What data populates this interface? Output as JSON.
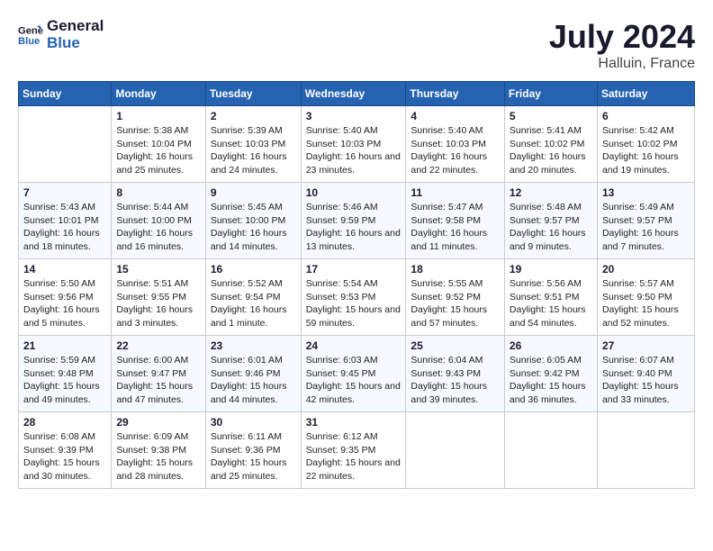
{
  "header": {
    "logo_line1": "General",
    "logo_line2": "Blue",
    "month_year": "July 2024",
    "location": "Halluin, France"
  },
  "weekdays": [
    "Sunday",
    "Monday",
    "Tuesday",
    "Wednesday",
    "Thursday",
    "Friday",
    "Saturday"
  ],
  "weeks": [
    [
      {
        "day": "",
        "sunrise": "",
        "sunset": "",
        "daylight": ""
      },
      {
        "day": "1",
        "sunrise": "Sunrise: 5:38 AM",
        "sunset": "Sunset: 10:04 PM",
        "daylight": "Daylight: 16 hours and 25 minutes."
      },
      {
        "day": "2",
        "sunrise": "Sunrise: 5:39 AM",
        "sunset": "Sunset: 10:03 PM",
        "daylight": "Daylight: 16 hours and 24 minutes."
      },
      {
        "day": "3",
        "sunrise": "Sunrise: 5:40 AM",
        "sunset": "Sunset: 10:03 PM",
        "daylight": "Daylight: 16 hours and 23 minutes."
      },
      {
        "day": "4",
        "sunrise": "Sunrise: 5:40 AM",
        "sunset": "Sunset: 10:03 PM",
        "daylight": "Daylight: 16 hours and 22 minutes."
      },
      {
        "day": "5",
        "sunrise": "Sunrise: 5:41 AM",
        "sunset": "Sunset: 10:02 PM",
        "daylight": "Daylight: 16 hours and 20 minutes."
      },
      {
        "day": "6",
        "sunrise": "Sunrise: 5:42 AM",
        "sunset": "Sunset: 10:02 PM",
        "daylight": "Daylight: 16 hours and 19 minutes."
      }
    ],
    [
      {
        "day": "7",
        "sunrise": "Sunrise: 5:43 AM",
        "sunset": "Sunset: 10:01 PM",
        "daylight": "Daylight: 16 hours and 18 minutes."
      },
      {
        "day": "8",
        "sunrise": "Sunrise: 5:44 AM",
        "sunset": "Sunset: 10:00 PM",
        "daylight": "Daylight: 16 hours and 16 minutes."
      },
      {
        "day": "9",
        "sunrise": "Sunrise: 5:45 AM",
        "sunset": "Sunset: 10:00 PM",
        "daylight": "Daylight: 16 hours and 14 minutes."
      },
      {
        "day": "10",
        "sunrise": "Sunrise: 5:46 AM",
        "sunset": "Sunset: 9:59 PM",
        "daylight": "Daylight: 16 hours and 13 minutes."
      },
      {
        "day": "11",
        "sunrise": "Sunrise: 5:47 AM",
        "sunset": "Sunset: 9:58 PM",
        "daylight": "Daylight: 16 hours and 11 minutes."
      },
      {
        "day": "12",
        "sunrise": "Sunrise: 5:48 AM",
        "sunset": "Sunset: 9:57 PM",
        "daylight": "Daylight: 16 hours and 9 minutes."
      },
      {
        "day": "13",
        "sunrise": "Sunrise: 5:49 AM",
        "sunset": "Sunset: 9:57 PM",
        "daylight": "Daylight: 16 hours and 7 minutes."
      }
    ],
    [
      {
        "day": "14",
        "sunrise": "Sunrise: 5:50 AM",
        "sunset": "Sunset: 9:56 PM",
        "daylight": "Daylight: 16 hours and 5 minutes."
      },
      {
        "day": "15",
        "sunrise": "Sunrise: 5:51 AM",
        "sunset": "Sunset: 9:55 PM",
        "daylight": "Daylight: 16 hours and 3 minutes."
      },
      {
        "day": "16",
        "sunrise": "Sunrise: 5:52 AM",
        "sunset": "Sunset: 9:54 PM",
        "daylight": "Daylight: 16 hours and 1 minute."
      },
      {
        "day": "17",
        "sunrise": "Sunrise: 5:54 AM",
        "sunset": "Sunset: 9:53 PM",
        "daylight": "Daylight: 15 hours and 59 minutes."
      },
      {
        "day": "18",
        "sunrise": "Sunrise: 5:55 AM",
        "sunset": "Sunset: 9:52 PM",
        "daylight": "Daylight: 15 hours and 57 minutes."
      },
      {
        "day": "19",
        "sunrise": "Sunrise: 5:56 AM",
        "sunset": "Sunset: 9:51 PM",
        "daylight": "Daylight: 15 hours and 54 minutes."
      },
      {
        "day": "20",
        "sunrise": "Sunrise: 5:57 AM",
        "sunset": "Sunset: 9:50 PM",
        "daylight": "Daylight: 15 hours and 52 minutes."
      }
    ],
    [
      {
        "day": "21",
        "sunrise": "Sunrise: 5:59 AM",
        "sunset": "Sunset: 9:48 PM",
        "daylight": "Daylight: 15 hours and 49 minutes."
      },
      {
        "day": "22",
        "sunrise": "Sunrise: 6:00 AM",
        "sunset": "Sunset: 9:47 PM",
        "daylight": "Daylight: 15 hours and 47 minutes."
      },
      {
        "day": "23",
        "sunrise": "Sunrise: 6:01 AM",
        "sunset": "Sunset: 9:46 PM",
        "daylight": "Daylight: 15 hours and 44 minutes."
      },
      {
        "day": "24",
        "sunrise": "Sunrise: 6:03 AM",
        "sunset": "Sunset: 9:45 PM",
        "daylight": "Daylight: 15 hours and 42 minutes."
      },
      {
        "day": "25",
        "sunrise": "Sunrise: 6:04 AM",
        "sunset": "Sunset: 9:43 PM",
        "daylight": "Daylight: 15 hours and 39 minutes."
      },
      {
        "day": "26",
        "sunrise": "Sunrise: 6:05 AM",
        "sunset": "Sunset: 9:42 PM",
        "daylight": "Daylight: 15 hours and 36 minutes."
      },
      {
        "day": "27",
        "sunrise": "Sunrise: 6:07 AM",
        "sunset": "Sunset: 9:40 PM",
        "daylight": "Daylight: 15 hours and 33 minutes."
      }
    ],
    [
      {
        "day": "28",
        "sunrise": "Sunrise: 6:08 AM",
        "sunset": "Sunset: 9:39 PM",
        "daylight": "Daylight: 15 hours and 30 minutes."
      },
      {
        "day": "29",
        "sunrise": "Sunrise: 6:09 AM",
        "sunset": "Sunset: 9:38 PM",
        "daylight": "Daylight: 15 hours and 28 minutes."
      },
      {
        "day": "30",
        "sunrise": "Sunrise: 6:11 AM",
        "sunset": "Sunset: 9:36 PM",
        "daylight": "Daylight: 15 hours and 25 minutes."
      },
      {
        "day": "31",
        "sunrise": "Sunrise: 6:12 AM",
        "sunset": "Sunset: 9:35 PM",
        "daylight": "Daylight: 15 hours and 22 minutes."
      },
      {
        "day": "",
        "sunrise": "",
        "sunset": "",
        "daylight": ""
      },
      {
        "day": "",
        "sunrise": "",
        "sunset": "",
        "daylight": ""
      },
      {
        "day": "",
        "sunrise": "",
        "sunset": "",
        "daylight": ""
      }
    ]
  ]
}
